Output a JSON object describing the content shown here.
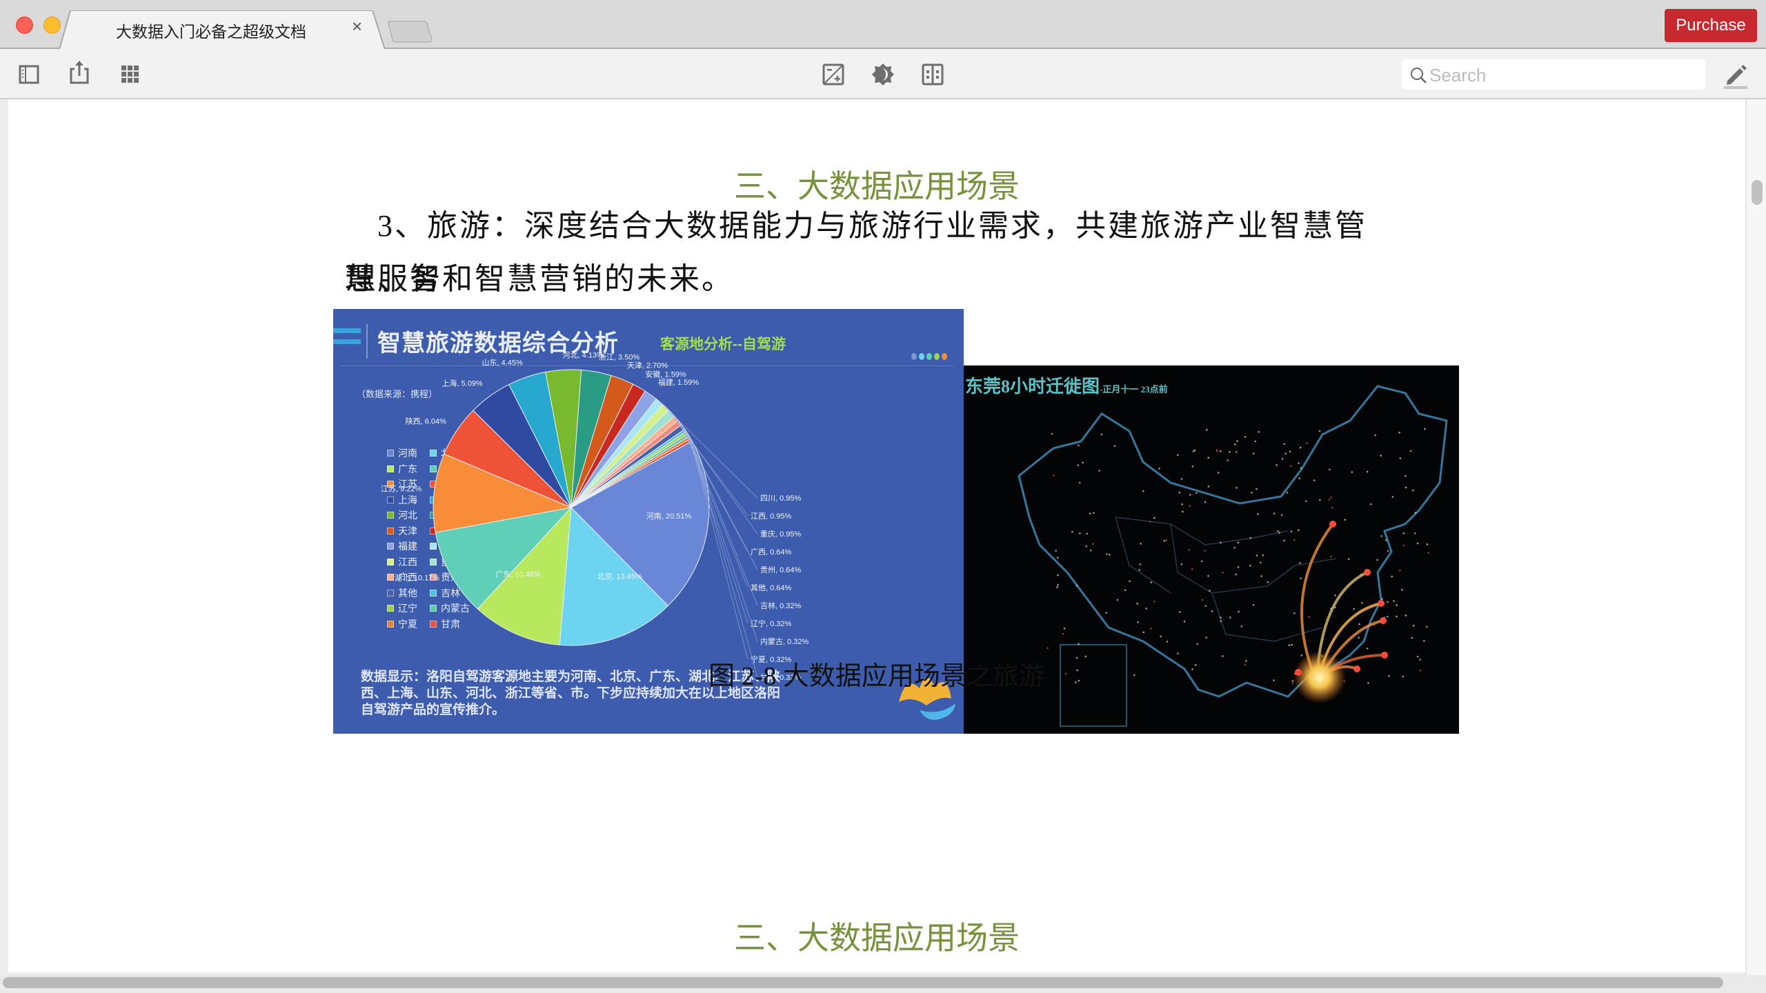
{
  "window": {
    "tab_title": "大数据入门必备之超级文档",
    "purchase_label": "Purchase"
  },
  "toolbar": {
    "search_placeholder": "Search",
    "search_value": ""
  },
  "document": {
    "heading_top": "三、大数据应用场景",
    "paragraph": "3、旅游：深度结合大数据能力与旅游行业需求，共建旅游产业智慧管理、智慧服务和智慧营销的未来。",
    "paragraph_line1": "　3、旅游：深度结合大数据能力与旅游行业需求，共建旅游产业智慧管理、智",
    "paragraph_line2": "慧服务和智慧营销的未来。",
    "caption": "图 2-8  大数据应用场景之旅游",
    "heading_bottom": "三、大数据应用场景"
  },
  "figure_left": {
    "title": "智慧旅游数据综合分析",
    "subtitle": "客源地分析--自驾游",
    "source_note": "（数据来源：携程）",
    "note": "数据显示：洛阳自驾游客源地主要为河南、北京、广东、湖北、江苏、陕西、上海、山东、河北、浙江等省、市。下步应持续加大在以上地区洛阳自驾游产品的宣传推介。"
  },
  "figure_right": {
    "title": "东莞8小时迁徙图",
    "subtitle": "-正月十一 23点前"
  },
  "chart_data": {
    "type": "pie",
    "title": "智慧旅游数据综合分析",
    "subtitle": "客源地分析--自驾游",
    "legend_position": "left",
    "categories": [
      "河南",
      "北京",
      "广东",
      "湖北",
      "江苏",
      "陕西",
      "上海",
      "山东",
      "河北",
      "浙江",
      "天津",
      "安徽",
      "福建",
      "四川",
      "江西",
      "重庆",
      "广西",
      "贵州",
      "其他",
      "吉林",
      "辽宁",
      "内蒙古",
      "宁夏",
      "甘肃"
    ],
    "values": [
      20.51,
      13.65,
      10.48,
      10.17,
      9.22,
      6.04,
      5.09,
      4.45,
      4.13,
      3.5,
      2.7,
      1.59,
      1.59,
      0.95,
      0.95,
      0.95,
      0.64,
      0.64,
      0.64,
      0.32,
      0.32,
      0.32,
      0.32,
      0.32
    ],
    "unit": "%",
    "colors": [
      "#6a86d6",
      "#6cd3f0",
      "#b8e85e",
      "#5fcfb8",
      "#f98c38",
      "#ee5237",
      "#2f4aa0",
      "#27a9cf",
      "#79b92d",
      "#2a9c83",
      "#d35a1a",
      "#c8281d",
      "#8da3e6",
      "#a8e6f6",
      "#d3f08a",
      "#9fe3d3",
      "#fab08a",
      "#f08a7a",
      "#4a5fa8",
      "#4fc0e3",
      "#9bd54b",
      "#5ac9a9",
      "#e3823f",
      "#e0543f"
    ],
    "labels": [
      "河南, 20.51%",
      "北京, 13.65%",
      "广东, 10.48%",
      "湖北, 10.17%",
      "江苏, 9.22%",
      "陕西, 6.04%",
      "上海, 5.09%",
      "山东, 4.45%",
      "河北, 4.13%",
      "浙江, 3.50%",
      "天津, 2.70%",
      "安徽, 1.59%",
      "福建, 1.59%",
      "四川, 0.95%",
      "江西, 0.95%",
      "重庆, 0.95%",
      "广西, 0.64%",
      "贵州, 0.64%",
      "其他, 0.64%",
      "吉林, 0.32%",
      "辽宁, 0.32%",
      "内蒙古, 0.32%",
      "宁夏, 0.32%",
      "甘肃, 0.32%"
    ]
  }
}
